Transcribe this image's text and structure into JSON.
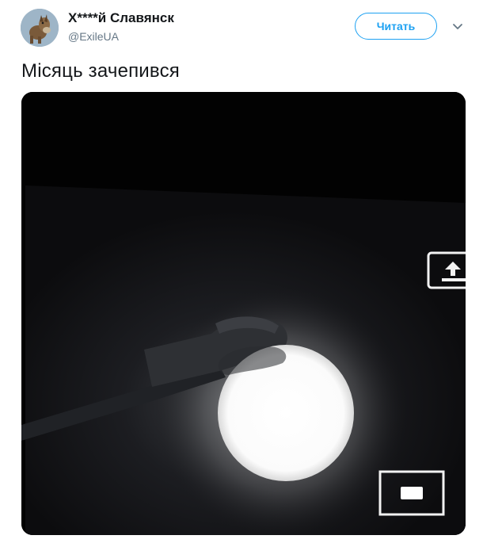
{
  "user": {
    "display_name": "Х****й Славянск",
    "handle": "@ExileUA",
    "avatar_icon": "donkey-avatar"
  },
  "follow_button": {
    "label": "Читать"
  },
  "menu": {
    "icon": "chevron-down-icon"
  },
  "tweet": {
    "text": "Місяць зачепився"
  },
  "media": {
    "description_icon": "moon-behind-street-lamp-photo",
    "camera_overlay_icons": [
      "switch-camera-icon",
      "video-mode-icon"
    ]
  },
  "colors": {
    "accent": "#1da1f2",
    "text_primary": "#14171a",
    "text_secondary": "#657786"
  }
}
